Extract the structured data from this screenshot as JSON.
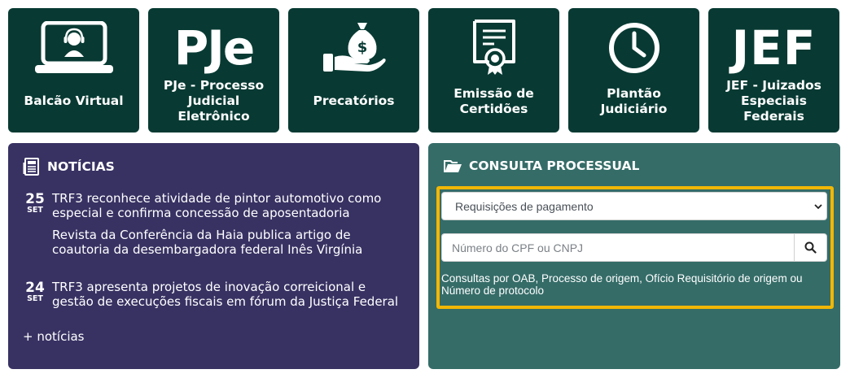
{
  "tiles": [
    {
      "icon": "virtual-desk-icon",
      "lines": [
        "Balcão Virtual"
      ]
    },
    {
      "icon": "pje-logo-icon",
      "logo_text": "PJe",
      "lines": [
        "PJe - Processo",
        "Judicial",
        "Eletrônico"
      ]
    },
    {
      "icon": "money-bag-hand-icon",
      "lines": [
        "Precatórios"
      ]
    },
    {
      "icon": "certificate-icon",
      "lines": [
        "Emissão de",
        "Certidões"
      ]
    },
    {
      "icon": "clock-icon",
      "lines": [
        "Plantão",
        "Judiciário"
      ]
    },
    {
      "icon": "jef-logo-icon",
      "logo_text": "JEF",
      "lines": [
        "JEF - Juizados",
        "Especiais",
        "Federais"
      ]
    }
  ],
  "news": {
    "title": "NOTÍCIAS",
    "items": [
      {
        "day": "25",
        "month": "SET",
        "lines": [
          "TRF3 reconhece atividade de pintor automotivo como",
          "especial e confirma concessão de aposentadoria"
        ]
      },
      {
        "day": "",
        "month": "",
        "lines": [
          "Revista da Conferência da Haia publica artigo de",
          "coautoria da desembargadora federal Inês Virgínia"
        ]
      },
      {
        "day": "24",
        "month": "SET",
        "lines": [
          "TRF3 apresenta projetos de inovação correicional e",
          "gestão de execuções fiscais em fórum da Justiça Federal"
        ]
      }
    ],
    "more_label": "+ notícias"
  },
  "consulta": {
    "title": "CONSULTA PROCESSUAL",
    "select_value": "Requisições de pagamento",
    "search_placeholder": "Número do CPF ou CNPJ",
    "hint": "Consultas por OAB, Processo de origem, Ofício Requisitório de origem ou Número de protocolo"
  },
  "colors": {
    "tile_bg": "#083a33",
    "news_bg": "#383263",
    "consulta_bg": "#356c68",
    "highlight": "#f2b705"
  }
}
